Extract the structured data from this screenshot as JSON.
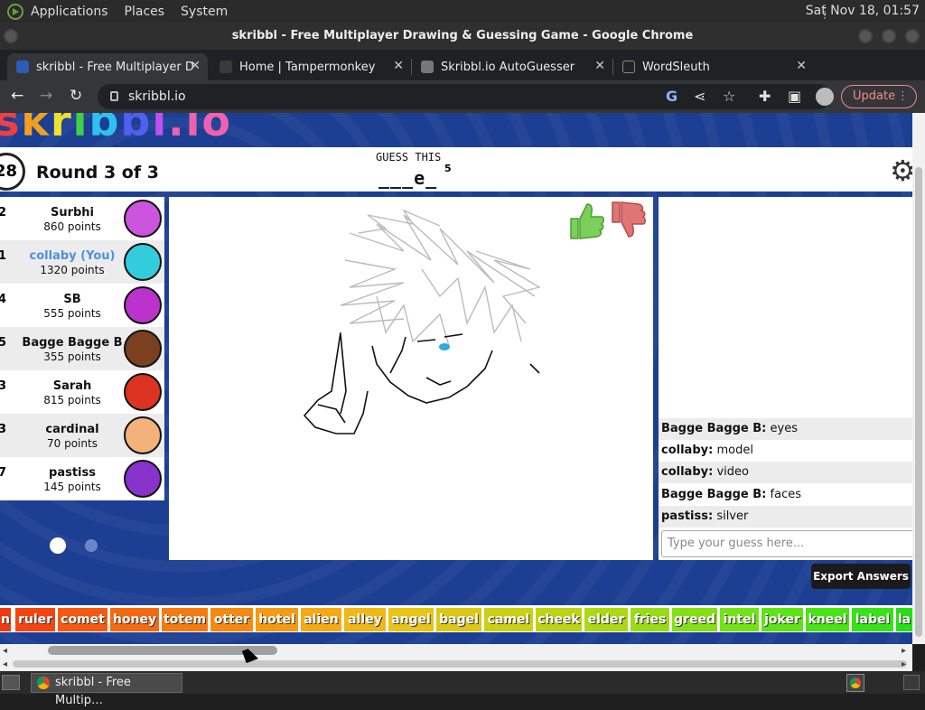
{
  "system": {
    "menus": [
      "Applications",
      "Places",
      "System"
    ],
    "clock": "Sat Nov 18, 01:57"
  },
  "window": {
    "title": "skribbl - Free Multiplayer Drawing & Guessing Game - Google Chrome"
  },
  "tabs": [
    {
      "label": "skribbl - Free Multiplayer D",
      "active": true
    },
    {
      "label": "Home | Tampermonkey",
      "active": false
    },
    {
      "label": "Skribbl.io AutoGuesser",
      "active": false
    },
    {
      "label": "WordSleuth",
      "active": false
    }
  ],
  "browser": {
    "url": "skribbl.io",
    "update_label": "Update",
    "new_tab": "+",
    "tab_menu": "⌄"
  },
  "game": {
    "logo_text": "skribbl.io",
    "timer": "28",
    "round": "Round 3 of 3",
    "guess_label": "GUESS THIS",
    "guess_word": "___e_",
    "guess_length": "5"
  },
  "players": [
    {
      "rank": "2",
      "name": "Surbhi",
      "points": "860 points",
      "color": "#cc55dd"
    },
    {
      "rank": "1",
      "name": "collaby (You)",
      "points": "1320 points",
      "color": "#33ccdd",
      "me": true
    },
    {
      "rank": "4",
      "name": "SB",
      "points": "555 points",
      "color": "#bb33cc"
    },
    {
      "rank": "5",
      "name": "Bagge Bagge B",
      "points": "355 points",
      "color": "#7a4020"
    },
    {
      "rank": "3",
      "name": "Sarah",
      "points": "815 points",
      "color": "#dd3322"
    },
    {
      "rank": "3",
      "name": "cardinal",
      "points": "70 points",
      "color": "#f2b27a"
    },
    {
      "rank": "7",
      "name": "pastiss",
      "points": "145 points",
      "color": "#8833cc"
    }
  ],
  "chat": {
    "messages": [
      {
        "author": "Bagge Bagge B:",
        "text": "eyes"
      },
      {
        "author": "collaby:",
        "text": "model"
      },
      {
        "author": "collaby:",
        "text": "video"
      },
      {
        "author": "Bagge Bagge B:",
        "text": "faces"
      },
      {
        "author": "pastiss:",
        "text": "silver"
      }
    ],
    "placeholder": "Type your guess here..."
  },
  "export_label": "Export Answers",
  "word_chips": [
    {
      "text": "n",
      "color": "#f03a10"
    },
    {
      "text": "ruler",
      "color": "#f54410"
    },
    {
      "text": "comet",
      "color": "#f55a10"
    },
    {
      "text": "honey",
      "color": "#f56a10"
    },
    {
      "text": "totem",
      "color": "#f57a10"
    },
    {
      "text": "otter",
      "color": "#f58a10"
    },
    {
      "text": "hotel",
      "color": "#f59a12"
    },
    {
      "text": "alien",
      "color": "#f5aa14"
    },
    {
      "text": "alley",
      "color": "#f0b814"
    },
    {
      "text": "angel",
      "color": "#e8c414"
    },
    {
      "text": "bagel",
      "color": "#dcc814"
    },
    {
      "text": "camel",
      "color": "#ccd014"
    },
    {
      "text": "cheek",
      "color": "#bcd414"
    },
    {
      "text": "elder",
      "color": "#acd814"
    },
    {
      "text": "fries",
      "color": "#98dc14"
    },
    {
      "text": "greed",
      "color": "#84e014"
    },
    {
      "text": "intel",
      "color": "#70e414"
    },
    {
      "text": "joker",
      "color": "#5ce414"
    },
    {
      "text": "kneel",
      "color": "#48e414"
    },
    {
      "text": "label",
      "color": "#34e414"
    },
    {
      "text": "la",
      "color": "#24e014"
    }
  ],
  "taskbar": {
    "task_label": "skribbl - Free Multip…"
  }
}
